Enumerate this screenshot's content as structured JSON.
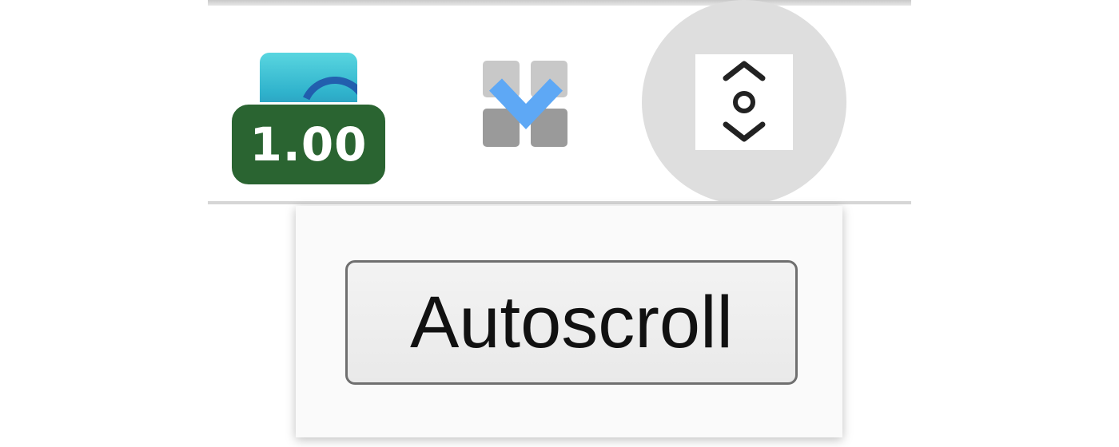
{
  "toolbar": {
    "extensions": [
      {
        "id": "speed",
        "icon": "video-speed-icon",
        "badge_text": "1.00",
        "badge_color": "#2a6431"
      },
      {
        "id": "chevron",
        "icon": "chevron-down-tile-icon",
        "accent_color": "#5ea8f5"
      },
      {
        "id": "autoscroll",
        "icon": "autoscroll-icon",
        "state": "active"
      }
    ]
  },
  "popup": {
    "button_label": "Autoscroll"
  }
}
